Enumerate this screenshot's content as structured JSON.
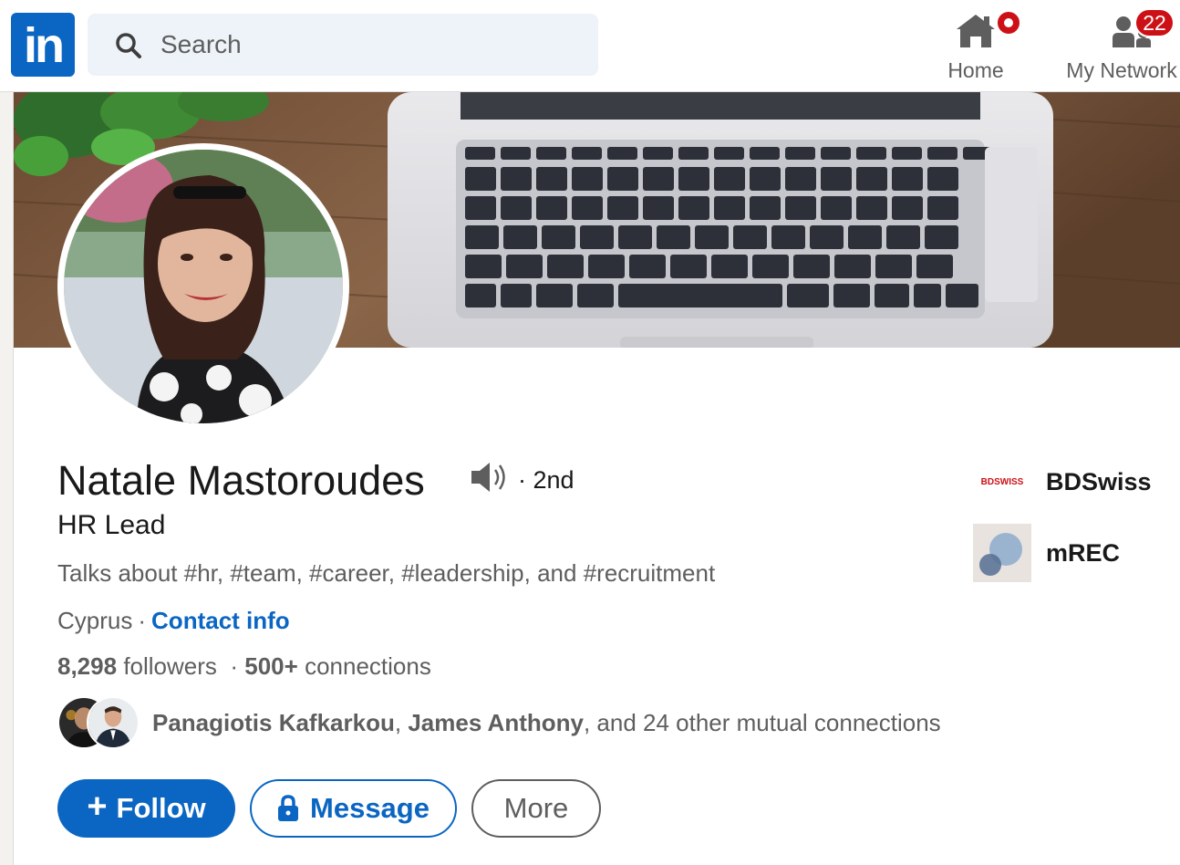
{
  "nav": {
    "logo_text": "in",
    "search_placeholder": "Search",
    "home_label": "Home",
    "network_label": "My Network",
    "network_badge": "22",
    "icons": [
      "linkedin-logo",
      "search-icon",
      "home-icon",
      "my-network-icon"
    ]
  },
  "profile": {
    "name": "Natale Mastoroudes",
    "degree": "· 2nd",
    "headline": "HR Lead",
    "talks_about": "Talks about #hr, #team, #career, #leadership, and #recruitment",
    "location": "Cyprus",
    "location_sep": "·",
    "contact_info": "Contact info",
    "followers_count": "8,298",
    "followers_label": "followers",
    "stats_sep": "·",
    "connections_count": "500+",
    "connections_label": "connections",
    "mutual_name_1": "Panagiotis Kafkarkou",
    "mutual_sep": ",",
    "mutual_name_2": "James Anthony",
    "mutual_rest": ", and 24 other mutual connections"
  },
  "actions": {
    "follow_plus": "+",
    "follow": "Follow",
    "message": "Message",
    "more": "More"
  },
  "companies": [
    {
      "logo_text": "BDSWISS",
      "name": "BDSwiss"
    },
    {
      "logo_text": "",
      "name": "mREC"
    }
  ],
  "colors": {
    "brand_blue": "#0a66c2",
    "badge_red": "#cc1016",
    "text_primary": "#191919",
    "text_secondary": "#5e5e5e"
  }
}
